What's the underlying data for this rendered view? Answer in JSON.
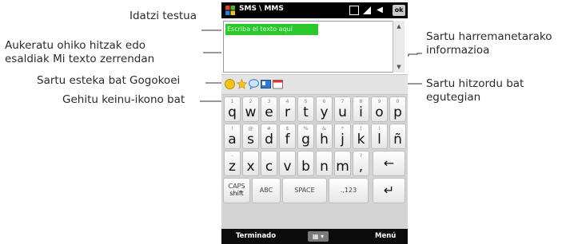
{
  "callouts": {
    "type_text": "Idatzi testua",
    "choose_phrases_line1": "Aukeratu ohiko hitzak edo",
    "choose_phrases_line2": "esaldiak Mi texto zerrendan",
    "add_favorite_link": "Sartu esteka bat Gogokoei",
    "add_emoticon": "Gehitu keinu-ikono bat",
    "add_contact_line1": "Sartu harremanetarako",
    "add_contact_line2": "informazioa",
    "add_appointment_line1": "Sartu hitzordu bat",
    "add_appointment_line2": "egutegian"
  },
  "phone": {
    "title": "SMS \\ MMS",
    "ok_label": "ok",
    "message_text": "Escriba el texto aquí",
    "softkey_left": "Terminado",
    "softkey_right": "Menú",
    "keyboard": {
      "row1": [
        {
          "n": "1",
          "l": "q"
        },
        {
          "n": "2",
          "l": "w"
        },
        {
          "n": "3",
          "l": "e"
        },
        {
          "n": "4",
          "l": "r"
        },
        {
          "n": "5",
          "l": "t"
        },
        {
          "n": "6",
          "l": "y"
        },
        {
          "n": "7",
          "l": "u"
        },
        {
          "n": "8",
          "l": "i"
        },
        {
          "n": "9",
          "l": "o"
        },
        {
          "n": "0",
          "l": "p"
        }
      ],
      "row2": [
        {
          "n": "!",
          "l": "a"
        },
        {
          "n": "@",
          "l": "s"
        },
        {
          "n": "#",
          "l": "d"
        },
        {
          "n": "$",
          "l": "f"
        },
        {
          "n": "%",
          "l": "g"
        },
        {
          "n": "&",
          "l": "h"
        },
        {
          "n": "*",
          "l": "j"
        },
        {
          "n": "(",
          "l": "k"
        },
        {
          "n": ")",
          "l": "l"
        },
        {
          "n": "",
          "l": "ñ"
        }
      ],
      "row3": [
        {
          "n": "-",
          "l": "z"
        },
        {
          "n": "",
          "l": "x"
        },
        {
          "n": "",
          "l": "c"
        },
        {
          "n": "",
          "l": "v"
        },
        {
          "n": "",
          "l": "b"
        },
        {
          "n": "",
          "l": "n"
        },
        {
          "n": "",
          "l": "m"
        },
        {
          "n": "?",
          "l": ","
        }
      ],
      "backspace": "←",
      "caps_label": "CAPS",
      "shift_label": "shift",
      "abc_label": "ABC",
      "space_label": "SPACE",
      "num_label": ".,123",
      "enter_label": "↵"
    }
  },
  "colors": {
    "text_highlight": "#2cc72c",
    "bar": "#000000",
    "keyboard_bg": "#d4d4d4"
  }
}
